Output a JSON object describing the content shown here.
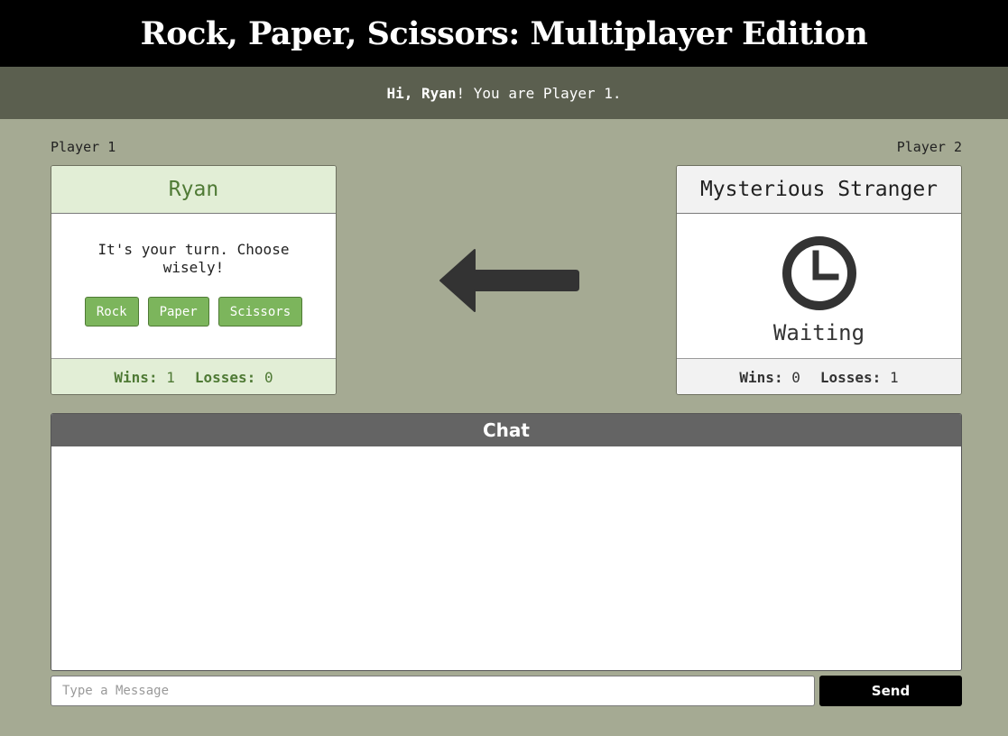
{
  "app": {
    "title": "Rock, Paper, Scissors: Multiplayer Edition"
  },
  "greeting": {
    "prefix": "Hi, ",
    "name": "Ryan",
    "suffix": "! You are Player 1."
  },
  "player1": {
    "label": "Player 1",
    "name": "Ryan",
    "prompt": "It's your turn. Choose wisely!",
    "choices": [
      "Rock",
      "Paper",
      "Scissors"
    ],
    "wins_label": "Wins:",
    "wins": "1",
    "losses_label": "Losses:",
    "losses": "0"
  },
  "player2": {
    "label": "Player 2",
    "name": "Mysterious Stranger",
    "status": "Waiting",
    "status_icon": "clock-icon",
    "wins_label": "Wins:",
    "wins": "0",
    "losses_label": "Losses:",
    "losses": "1"
  },
  "turn_indicator": {
    "icon": "arrow-left-icon",
    "points_to": "player1"
  },
  "chat": {
    "title": "Chat",
    "messages": [],
    "input_placeholder": "Type a Message",
    "input_value": "",
    "send_label": "Send"
  },
  "colors": {
    "background": "#a5aa93",
    "header": "#000000",
    "greeting_bar": "#5b5f4f",
    "active_player": "#e2eed6",
    "active_accent": "#4f7a35",
    "button": "#7cb55c",
    "chat_header": "#646464"
  }
}
